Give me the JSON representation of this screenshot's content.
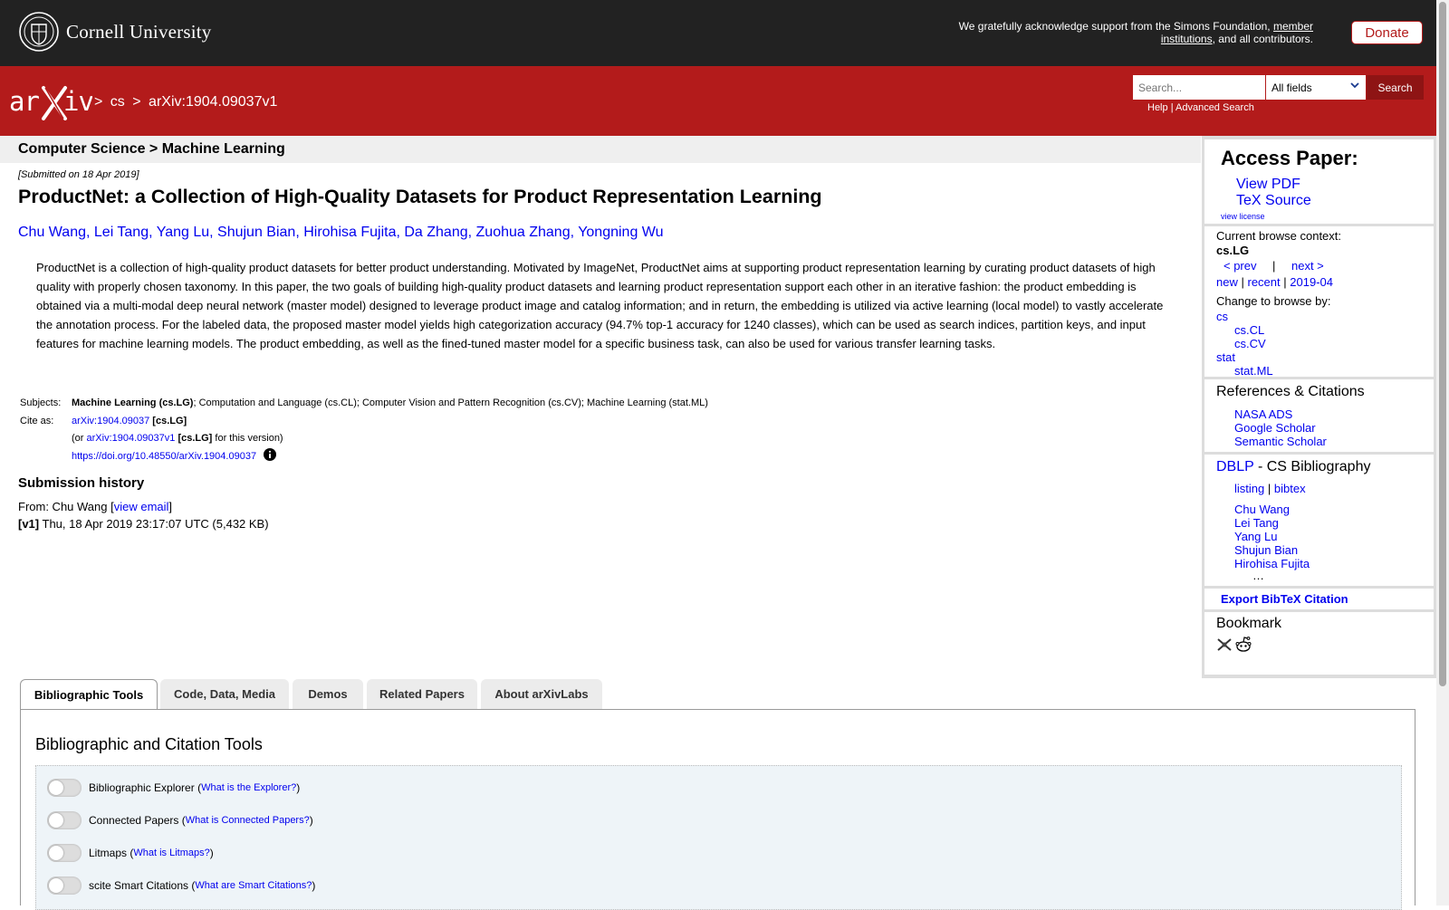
{
  "topbar": {
    "university": "Cornell University",
    "support_text": "We gratefully acknowledge support from the Simons Foundation,",
    "support_link": "member institutions",
    "support_tail": ", and all contributors.",
    "donate": "Donate"
  },
  "header": {
    "crumb_sep1": ">",
    "crumb_cs": "cs",
    "crumb_sep2": ">",
    "crumb_id": "arXiv:1904.09037v1",
    "search_placeholder": "Search...",
    "search_field": "All fields",
    "search_button": "Search",
    "help": "Help",
    "sep": "|",
    "advanced": "Advanced Search",
    "brand_color": "#b31b1b"
  },
  "paper": {
    "category_path": "Computer Science > Machine Learning",
    "submitted": "[Submitted on 18 Apr 2019]",
    "title": "ProductNet: a Collection of High-Quality Datasets for Product Representation Learning",
    "authors": [
      "Chu Wang",
      "Lei Tang",
      "Yang Lu",
      "Shujun Bian",
      "Hirohisa Fujita",
      "Da Zhang",
      "Zuohua Zhang",
      "Yongning Wu"
    ],
    "abstract": "ProductNet is a collection of high-quality product datasets for better product understanding. Motivated by ImageNet, ProductNet aims at supporting product representation learning by curating product datasets of high quality with properly chosen taxonomy. In this paper, the two goals of building high-quality product datasets and learning product representation support each other in an iterative fashion: the product embedding is obtained via a multi-modal deep neural network (master model) designed to leverage product image and catalog information; and in return, the embedding is utilized via active learning (local model) to vastly accelerate the annotation process. For the labeled data, the proposed master model yields high categorization accuracy (94.7% top-1 accuracy for 1240 classes), which can be used as search indices, partition keys, and input features for machine learning models. The product embedding, as well as the fined-tuned master model for a specific business task, can also be used for various transfer learning tasks.",
    "subjects_label": "Subjects:",
    "subjects_primary": "Machine Learning (cs.LG)",
    "subjects_rest": "; Computation and Language (cs.CL); Computer Vision and Pattern Recognition (cs.CV); Machine Learning (stat.ML)",
    "cite_label": "Cite as:",
    "cite_id": "arXiv:1904.09037",
    "cite_cat": "[cs.LG]",
    "cite_or": "(or",
    "cite_version_id": "arXiv:1904.09037v1",
    "cite_version_cat": "[cs.LG]",
    "cite_version_tail": "for this version)",
    "doi": "https://doi.org/10.48550/arXiv.1904.09037",
    "history_heading": "Submission history",
    "history_from": "From: Chu Wang [",
    "history_email": "view email",
    "history_close": "]",
    "history_v1": "[v1]",
    "history_v1_text": "Thu, 18 Apr 2019 23:17:07 UTC (5,432 KB)"
  },
  "sidebar": {
    "access_title": "Access Paper:",
    "view_pdf": "View PDF",
    "tex_source": "TeX Source",
    "view_license": "view license",
    "context_label": "Current browse context:",
    "context_value": "cs.LG",
    "prev": "< prev",
    "bar": "|",
    "next": "next >",
    "new": "new",
    "recent": "recent",
    "month": "2019-04",
    "change_label": "Change to browse by:",
    "browse": [
      "cs",
      "cs.CL",
      "cs.CV",
      "stat",
      "stat.ML"
    ],
    "refs_heading": "References & Citations",
    "refs": [
      "NASA ADS",
      "Google Scholar",
      "Semantic Scholar"
    ],
    "dblp": "DBLP",
    "dblp_tail": " - CS Bibliography",
    "listing": "listing",
    "bibtex": "bibtex",
    "dblp_authors": [
      "Chu Wang",
      "Lei Tang",
      "Yang Lu",
      "Shujun Bian",
      "Hirohisa Fujita"
    ],
    "ellipsis": "…",
    "export": "Export BibTeX Citation",
    "bookmark": "Bookmark"
  },
  "tabs": {
    "items": [
      "Bibliographic Tools",
      "Code, Data, Media",
      "Demos",
      "Related Papers",
      "About arXivLabs"
    ],
    "active": "Bibliographic Tools",
    "panel_heading": "Bibliographic and Citation Tools",
    "tools": [
      {
        "label": "Bibliographic Explorer",
        "link": "What is the Explorer?"
      },
      {
        "label": "Connected Papers",
        "link": "What is Connected Papers?"
      },
      {
        "label": "Litmaps",
        "link": "What is Litmaps?"
      },
      {
        "label": "scite Smart Citations",
        "link": "What are Smart Citations?"
      }
    ]
  }
}
